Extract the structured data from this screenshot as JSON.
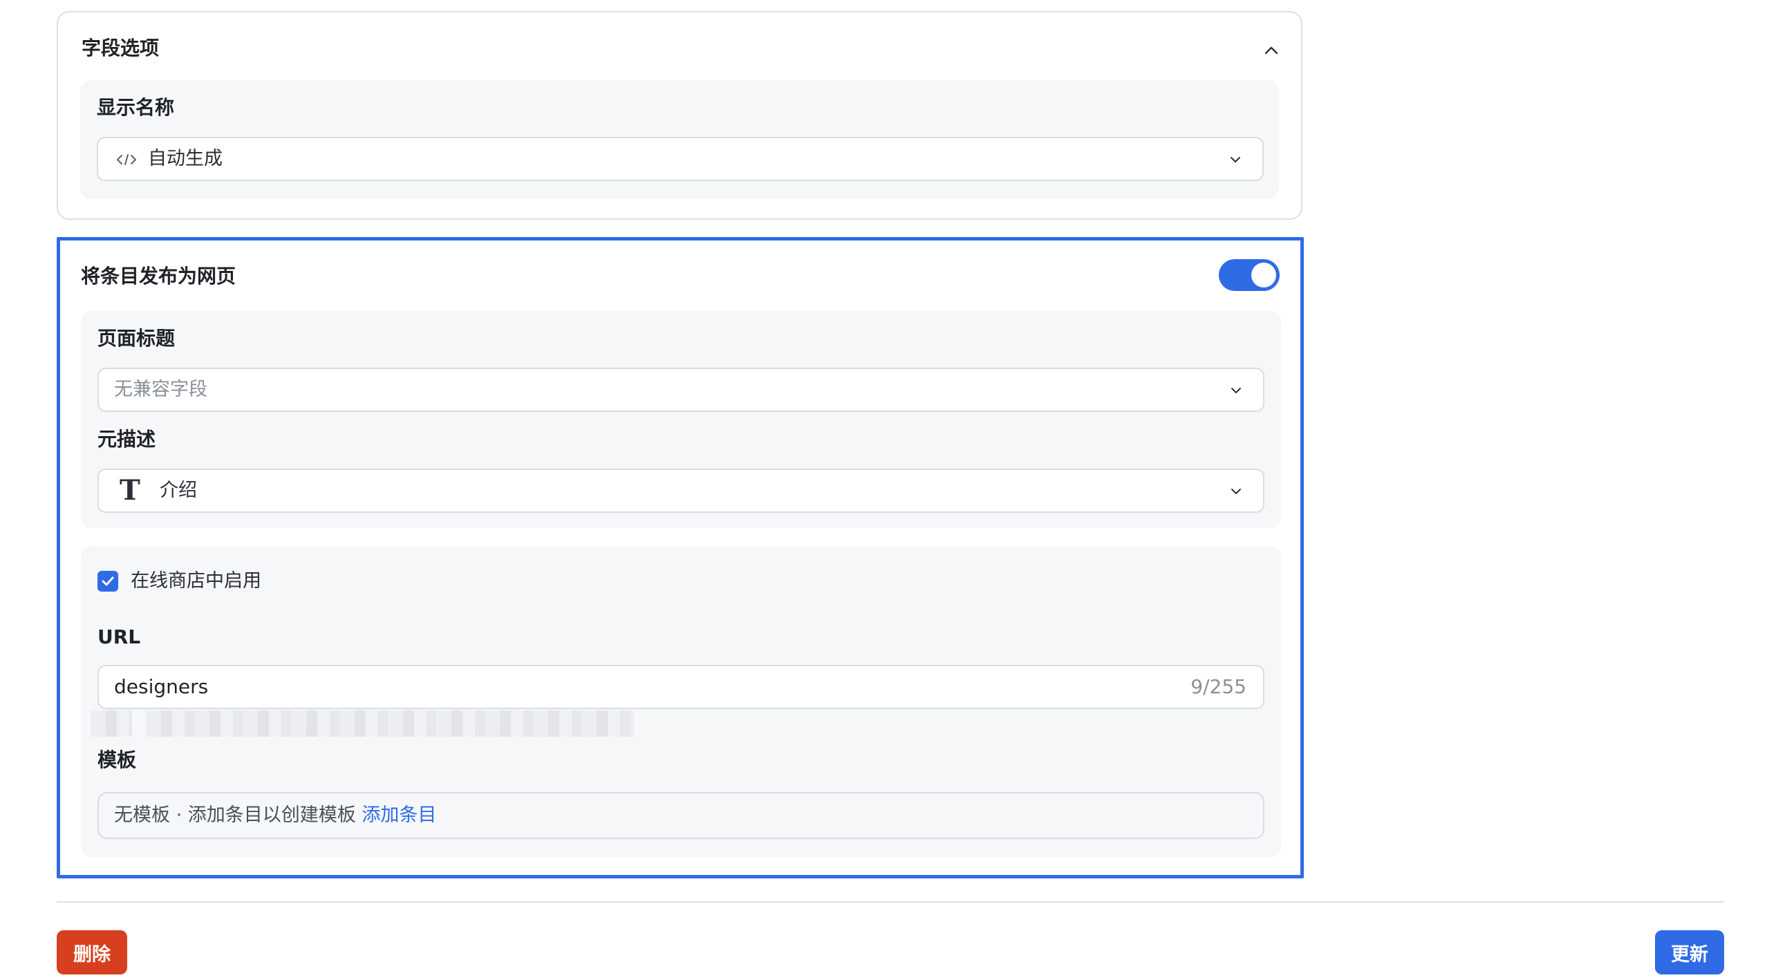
{
  "field_options": {
    "title": "字段选项",
    "display_name": {
      "label": "显示名称",
      "icon": "code-icon",
      "value": "自动生成"
    }
  },
  "publish": {
    "title": "将条目发布为网页",
    "toggle_on": true,
    "page_title": {
      "label": "页面标题",
      "placeholder": "无兼容字段"
    },
    "meta_description": {
      "label": "元描述",
      "icon": "text-type-icon",
      "icon_glyph": "T",
      "value": "介绍"
    },
    "online_store": {
      "checkbox_checked": true,
      "checkbox_label": "在线商店中启用"
    },
    "url": {
      "label": "URL",
      "value": "designers",
      "char_count": "9/255"
    },
    "template": {
      "label": "模板",
      "empty_text": "无模板 · 添加条目以创建模板",
      "link_text": "添加条目"
    }
  },
  "actions": {
    "delete_label": "删除",
    "update_label": "更新"
  },
  "colors": {
    "accent": "#2f6be5",
    "danger": "#d7401e"
  }
}
